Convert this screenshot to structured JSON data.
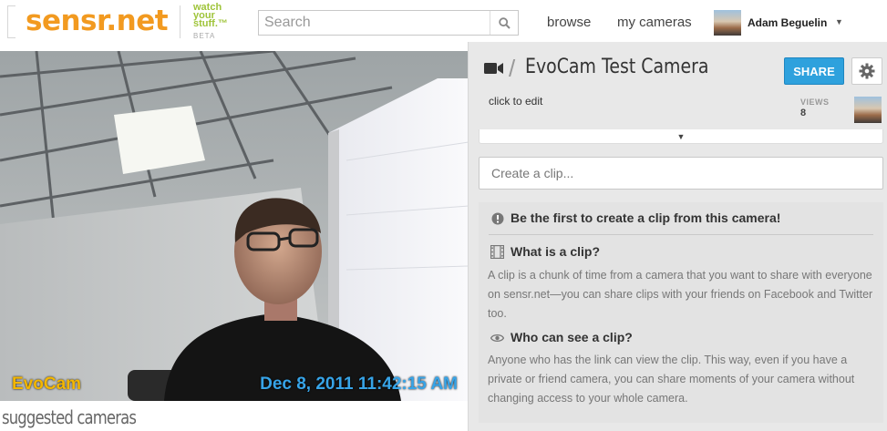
{
  "header": {
    "logo": "sensr.net",
    "tagline": [
      "watch",
      "your",
      "stuff.™"
    ],
    "beta": "BETA",
    "search_placeholder": "Search",
    "nav": {
      "browse": "browse",
      "my_cameras": "my cameras"
    },
    "user_name": "Adam Beguelin"
  },
  "feed": {
    "camera_overlay": "EvoCam",
    "timestamp_overlay": "Dec 8, 2011 11:42:15 AM"
  },
  "suggested_label": "suggested cameras",
  "panel": {
    "camera_title": "EvoCam Test Camera",
    "share_label": "SHARE",
    "click_to_edit": "click to edit",
    "views_label": "VIEWS",
    "views_count": "8",
    "clip_placeholder": "Create a clip...",
    "info": {
      "first_clip": "Be the first to create a clip from this camera!",
      "what_title": "What is a clip?",
      "what_body": "A clip is a chunk of time from a camera that you want to share with everyone on sensr.net—you can share clips with your friends on Facebook and Twitter too.",
      "who_title": "Who can see a clip?",
      "who_body": "Anyone who has the link can view the clip. This way, even if you have a private or friend camera, you can share moments of your camera without changing access to your whole camera."
    }
  },
  "colors": {
    "logo_orange": "#f29a20",
    "tagline_green": "#9fc43a",
    "share_blue": "#2ea1dd",
    "overlay_yellow": "#f3b600",
    "overlay_blue": "#37a4e8"
  }
}
